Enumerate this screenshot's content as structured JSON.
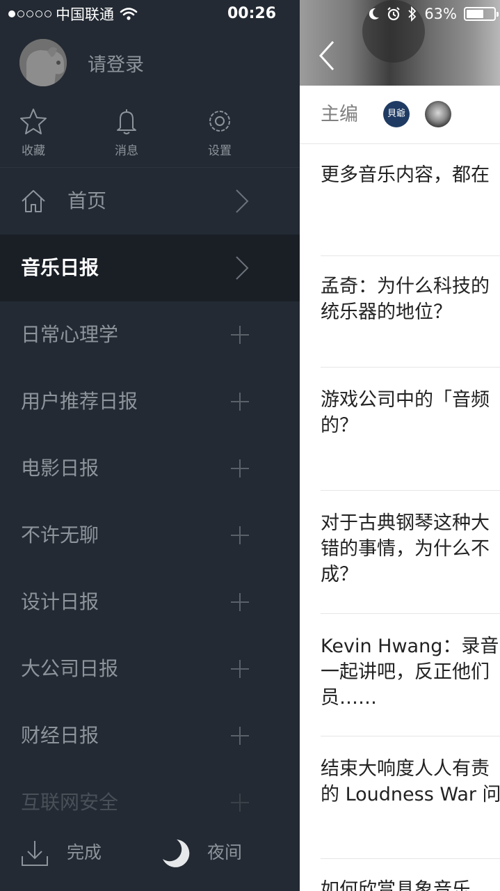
{
  "status_bar": {
    "carrier": "中国联通",
    "time": "00:26",
    "battery": "63%",
    "battery_level": 0.63
  },
  "drawer": {
    "login_text": "请登录",
    "quick_actions": [
      {
        "label": "收藏",
        "icon": "star-icon"
      },
      {
        "label": "消息",
        "icon": "bell-icon"
      },
      {
        "label": "设置",
        "icon": "gear-icon"
      }
    ],
    "nav": [
      {
        "label": "首页",
        "icon": "home-icon",
        "trailing": "chevron"
      },
      {
        "label": "音乐日报",
        "trailing": "chevron",
        "active": true
      },
      {
        "label": "日常心理学",
        "trailing": "plus"
      },
      {
        "label": "用户推荐日报",
        "trailing": "plus"
      },
      {
        "label": "电影日报",
        "trailing": "plus"
      },
      {
        "label": "不许无聊",
        "trailing": "plus"
      },
      {
        "label": "设计日报",
        "trailing": "plus"
      },
      {
        "label": "大公司日报",
        "trailing": "plus"
      },
      {
        "label": "财经日报",
        "trailing": "plus"
      },
      {
        "label": "互联网安全",
        "trailing": "plus"
      }
    ],
    "bottom": {
      "download_label": "完成",
      "night_label": "夜间"
    }
  },
  "content": {
    "editor_label": "主编",
    "editor_avatar_text": "貝爺",
    "articles": [
      "更多音乐内容，都在",
      "孟奇：为什么科技的\n统乐器的地位？",
      "游戏公司中的「音频\n的？",
      "对于古典钢琴这种大\n错的事情，为什么不\n成？",
      "Kevin Hwang：录音\n一起讲吧，反正他们\n员……",
      "结束大响度人人有责\n的 Loudness War 问",
      "如何欣赏具象音乐"
    ]
  },
  "colors": {
    "drawer_bg": "#232a33",
    "active_row_bg": "#1a1f26",
    "muted_text": "#8e949b",
    "editor_avatar_bg": "#1f3b63"
  }
}
